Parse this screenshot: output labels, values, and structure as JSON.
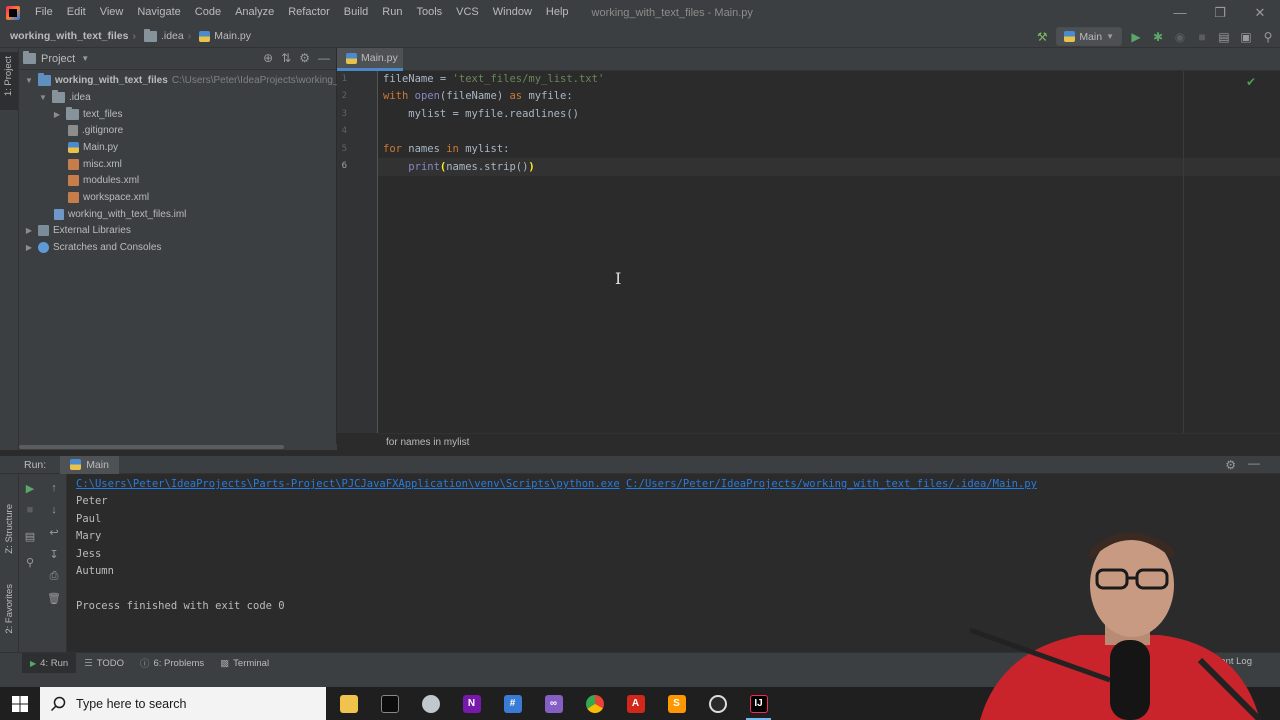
{
  "menu": {
    "items": [
      "File",
      "Edit",
      "View",
      "Navigate",
      "Code",
      "Analyze",
      "Refactor",
      "Build",
      "Run",
      "Tools",
      "VCS",
      "Window",
      "Help"
    ],
    "window_title": "working_with_text_files - Main.py"
  },
  "navbar": {
    "crumbs": [
      "working_with_text_files",
      ".idea",
      "Main.py"
    ],
    "run_config": "Main"
  },
  "left_strip": {
    "project_label": "1: Project"
  },
  "project_panel": {
    "title": "Project",
    "tree": [
      {
        "label": "working_with_text_files",
        "path": "C:\\Users\\Peter\\IdeaProjects\\working_",
        "icon": "folder",
        "bold": true
      },
      {
        "label": ".idea",
        "icon": "folder"
      },
      {
        "label": "text_files",
        "icon": "folder"
      },
      {
        "label": ".gitignore",
        "icon": "git-file"
      },
      {
        "label": "Main.py",
        "icon": "python-file"
      },
      {
        "label": "misc.xml",
        "icon": "xml-file"
      },
      {
        "label": "modules.xml",
        "icon": "xml-file"
      },
      {
        "label": "workspace.xml",
        "icon": "xml-file"
      },
      {
        "label": "working_with_text_files.iml",
        "icon": "iml-file"
      },
      {
        "label": "External Libraries",
        "icon": "library"
      },
      {
        "label": "Scratches and Consoles",
        "icon": "scratch"
      }
    ]
  },
  "editor": {
    "tab": "Main.py",
    "line_numbers": [
      "1",
      "2",
      "3",
      "4",
      "5",
      "6"
    ],
    "current_line": "6",
    "breadcrumb": "for names in mylist"
  },
  "run_panel": {
    "label": "Run:",
    "tab": "Main",
    "command_python": "C:\\Users\\Peter\\IdeaProjects\\Parts-Project\\PJCJavaFXApplication\\venv\\Scripts\\python.exe",
    "command_script": "C:/Users/Peter/IdeaProjects/working_with_text_files/.idea/Main.py",
    "output": [
      "Peter",
      "Paul",
      "Mary",
      "Jess",
      "Autumn"
    ],
    "finished": "Process finished with exit code 0",
    "side_labels": [
      "Z: Structure",
      "2: Favorites"
    ]
  },
  "bottom_tabs": {
    "run": "4: Run",
    "todo": "TODO",
    "problems": "6: Problems",
    "terminal": "Terminal",
    "event_log": "Event Log"
  },
  "taskbar": {
    "search_placeholder": "Type here to search"
  },
  "colors": {
    "keyword": "#cc7832",
    "string": "#6a8759",
    "builtin": "#8888c6",
    "link": "#287bde",
    "accent": "#4a88c7"
  }
}
